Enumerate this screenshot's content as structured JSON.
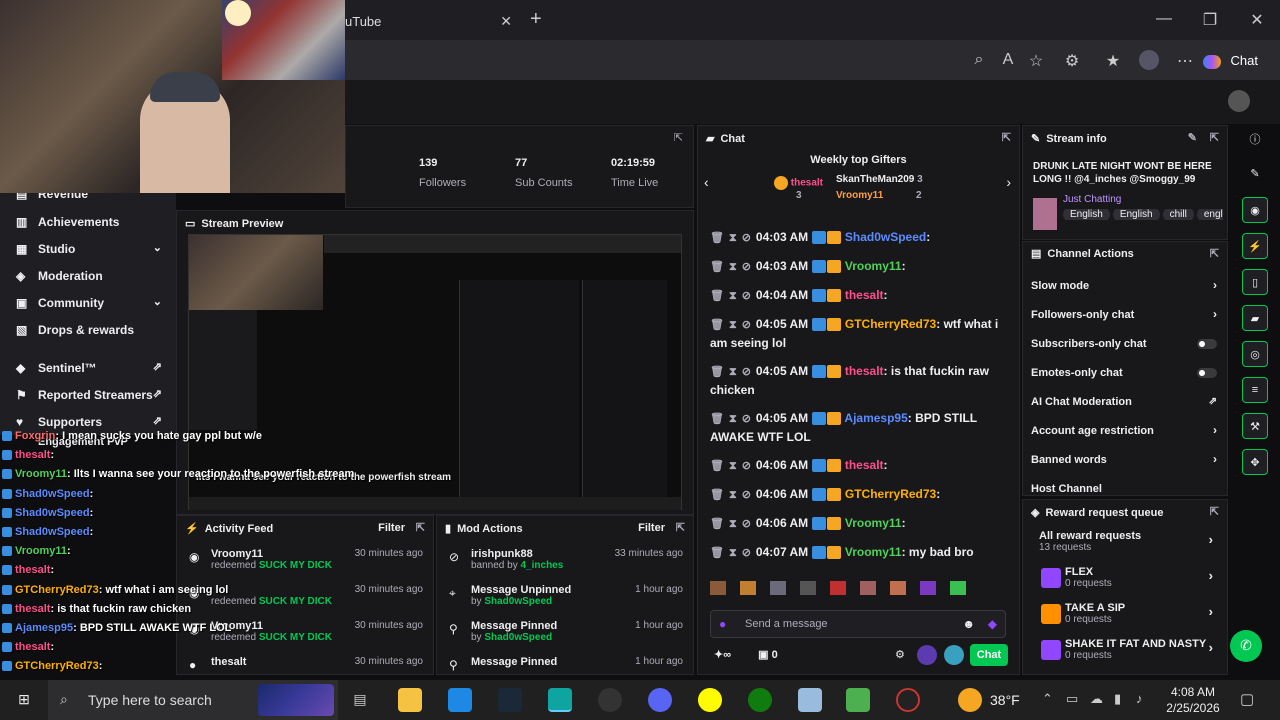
{
  "browser": {
    "tab_title": "uTube",
    "copilot_label": "Chat"
  },
  "sidebar": {
    "items": [
      {
        "label": "Revenue"
      },
      {
        "label": "Achievements"
      },
      {
        "label": "Studio"
      },
      {
        "label": "Moderation"
      },
      {
        "label": "Community"
      },
      {
        "label": "Drops & rewards"
      },
      {
        "label": "Sentinel™"
      },
      {
        "label": "Reported Streamers"
      },
      {
        "label": "Supporters"
      },
      {
        "label": "Engagement PvP"
      }
    ]
  },
  "stats": [
    {
      "value": "139",
      "label": "Followers"
    },
    {
      "value": "77",
      "label": "Sub Counts"
    },
    {
      "value": "02:19:59",
      "label": "Time Live"
    }
  ],
  "preview": {
    "title": "Stream Preview",
    "overlay_text": "Ilts I wanna see your reaction to the powerfish stream"
  },
  "overlay_chat": [
    {
      "user": "Foxgrin",
      "text": ": I mean sucks you hate gay ppl but w/e",
      "color": "#ff6b6b"
    },
    {
      "user": "thesalt",
      "text": ":",
      "color": "#ff4f8b"
    },
    {
      "user": "Vroomy11",
      "text": ": Ilts I wanna see your reaction to the powerfish stream",
      "color": "#4fd15a"
    },
    {
      "user": "Shad0wSpeed",
      "text": ":",
      "color": "#5b8cff"
    },
    {
      "user": "Shad0wSpeed",
      "text": ":",
      "color": "#5b8cff"
    },
    {
      "user": "Shad0wSpeed",
      "text": ":",
      "color": "#5b8cff"
    },
    {
      "user": "Vroomy11",
      "text": ":",
      "color": "#4fd15a"
    },
    {
      "user": "thesalt",
      "text": ":",
      "color": "#ff4f8b"
    },
    {
      "user": "GTCherryRed73",
      "text": ": wtf what i am seeing lol",
      "color": "#ffb000"
    },
    {
      "user": "thesalt",
      "text": ": is that fuckin raw chicken",
      "color": "#ff4f8b"
    },
    {
      "user": "Ajamesp95",
      "text": ": BPD STILL AWAKE WTF LOL",
      "color": "#5b8cff"
    },
    {
      "user": "thesalt",
      "text": ":",
      "color": "#ff4f8b"
    },
    {
      "user": "GTCherryRed73",
      "text": ":",
      "color": "#ffb000"
    },
    {
      "user": "Vroomy11",
      "text": ":",
      "color": "#4fd15a"
    },
    {
      "user": "Vroomy11",
      "text": ": my bad bro",
      "color": "#4fd15a"
    }
  ],
  "activity": {
    "title": "Activity Feed",
    "filter": "Filter",
    "items": [
      {
        "name": "Vroomy11",
        "action": "redeemed",
        "reward": "SUCK MY DICK",
        "time": "30 minutes ago"
      },
      {
        "name": "",
        "action": "redeemed",
        "reward": "SUCK MY DICK",
        "time": "30 minutes ago"
      },
      {
        "name": "Vroomy11",
        "action": "redeemed",
        "reward": "SUCK MY DICK",
        "time": "30 minutes ago"
      },
      {
        "name": "thesalt",
        "action": "",
        "reward": "",
        "time": "30 minutes ago"
      }
    ]
  },
  "mod_actions": {
    "title": "Mod Actions",
    "filter": "Filter",
    "items": [
      {
        "name": "irishpunk88",
        "sub_prefix": "banned by",
        "sub_user": "4_inches",
        "time": "33 minutes ago"
      },
      {
        "name": "Message Unpinned",
        "sub_prefix": "by",
        "sub_user": "Shad0wSpeed",
        "time": "1 hour ago"
      },
      {
        "name": "Message Pinned",
        "sub_prefix": "by",
        "sub_user": "Shad0wSpeed",
        "time": "1 hour ago"
      },
      {
        "name": "Message Pinned",
        "sub_prefix": "",
        "sub_user": "",
        "time": "1 hour ago"
      }
    ]
  },
  "chat": {
    "title": "Chat",
    "gifters_title": "Weekly top Gifters",
    "gifters": [
      {
        "name": "thesalt",
        "count": "3"
      },
      {
        "name": "SkanTheMan209",
        "count": "3"
      },
      {
        "name": "Vroomy11",
        "count": "2"
      }
    ],
    "messages": [
      {
        "time": "04:03 AM",
        "user": "Shad0wSpeed",
        "color": "#5b8cff",
        "text": ":"
      },
      {
        "time": "04:03 AM",
        "user": "Vroomy11",
        "color": "#4fd15a",
        "text": ":"
      },
      {
        "time": "04:04 AM",
        "user": "thesalt",
        "color": "#ff4f8b",
        "text": ":"
      },
      {
        "time": "04:05 AM",
        "user": "GTCherryRed73",
        "color": "#ffb000",
        "text": ": wtf what i am seeing lol"
      },
      {
        "time": "04:05 AM",
        "user": "thesalt",
        "color": "#ff4f8b",
        "text": ": is that fuckin raw chicken"
      },
      {
        "time": "04:05 AM",
        "user": "Ajamesp95",
        "color": "#5b8cff",
        "text": ": BPD STILL AWAKE WTF LOL"
      },
      {
        "time": "04:06 AM",
        "user": "thesalt",
        "color": "#ff4f8b",
        "text": ":"
      },
      {
        "time": "04:06 AM",
        "user": "GTCherryRed73",
        "color": "#ffb000",
        "text": ":"
      },
      {
        "time": "04:06 AM",
        "user": "Vroomy11",
        "color": "#4fd15a",
        "text": ":"
      },
      {
        "time": "04:07 AM",
        "user": "Vroomy11",
        "color": "#4fd15a",
        "text": ": my bad bro"
      }
    ],
    "input_placeholder": "Send a message",
    "points": "0",
    "send_label": "Chat"
  },
  "stream_info": {
    "title": "Stream info",
    "stream_title": "DRUNK LATE NIGHT WONT BE HERE LONG !! @4_inches @Smoggy_99",
    "category": "Just Chatting",
    "tags": [
      "English",
      "English",
      "chill",
      "englis"
    ]
  },
  "channel_actions": {
    "title": "Channel Actions",
    "rows": [
      {
        "label": "Slow mode",
        "kind": "chevron"
      },
      {
        "label": "Followers-only chat",
        "kind": "chevron"
      },
      {
        "label": "Subscribers-only chat",
        "kind": "toggle"
      },
      {
        "label": "Emotes-only chat",
        "kind": "toggle"
      },
      {
        "label": "AI Chat Moderation",
        "kind": "external"
      },
      {
        "label": "Account age restriction",
        "kind": "chevron"
      },
      {
        "label": "Banned words",
        "kind": "chevron"
      },
      {
        "label": "Host Channel",
        "kind": "none"
      }
    ]
  },
  "reward_queue": {
    "title": "Reward request queue",
    "all_label": "All reward requests",
    "all_count": "13 requests",
    "items": [
      {
        "name": "FLEX",
        "count": "0 requests",
        "color": "#9147ff"
      },
      {
        "name": "TAKE A SIP",
        "count": "0 requests",
        "color": "#ff9100"
      },
      {
        "name": "SHAKE IT FAT AND NASTY",
        "count": "0 requests",
        "color": "#9147ff"
      }
    ]
  },
  "taskbar": {
    "search_placeholder": "Type here to search",
    "weather": "38°F",
    "time": "4:08 AM",
    "date": "2/25/2026"
  },
  "colors": {
    "accent": "#9147ff",
    "send": "#00c853"
  }
}
